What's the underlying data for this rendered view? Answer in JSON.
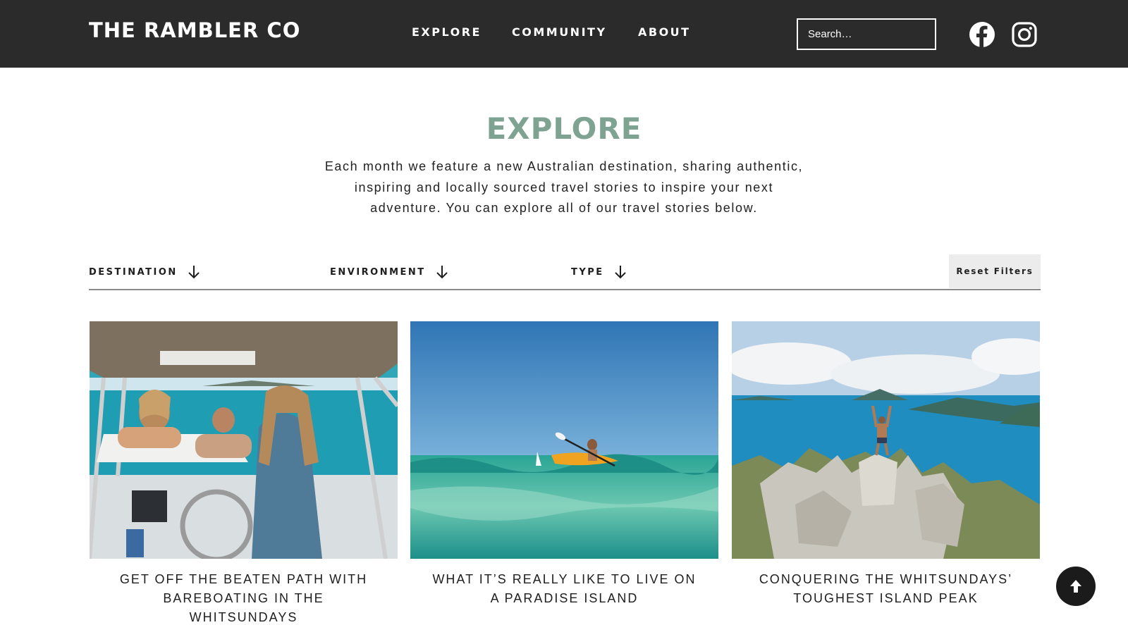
{
  "header": {
    "logo": "THE RAMBLER CO",
    "nav": [
      {
        "label": "EXPLORE"
      },
      {
        "label": "COMMUNITY"
      },
      {
        "label": "ABOUT"
      }
    ],
    "search_placeholder": "Search…",
    "social": [
      "facebook-icon",
      "instagram-icon"
    ]
  },
  "main": {
    "title": "EXPLORE",
    "intro": "Each month we feature a new Australian destination, sharing authentic, inspiring and locally sourced travel stories to inspire your next adventure. You can explore all of our travel stories below.",
    "filters": [
      {
        "label": "DESTINATION"
      },
      {
        "label": "ENVIRONMENT"
      },
      {
        "label": "TYPE"
      }
    ],
    "reset_label": "Reset Filters",
    "cards": [
      {
        "title": "GET OFF THE BEATEN PATH WITH BAREBOATING IN THE WHITSUNDAYS"
      },
      {
        "title": "WHAT IT’S REALLY LIKE TO LIVE ON A PARADISE ISLAND"
      },
      {
        "title": "CONQUERING THE WHITSUNDAYS’ TOUGHEST ISLAND PEAK"
      }
    ]
  },
  "colors": {
    "header_bg": "#2b2b2b",
    "accent_title": "#7fa393",
    "reset_bg": "#ececec",
    "back_to_top_bg": "#1b1b1b"
  }
}
